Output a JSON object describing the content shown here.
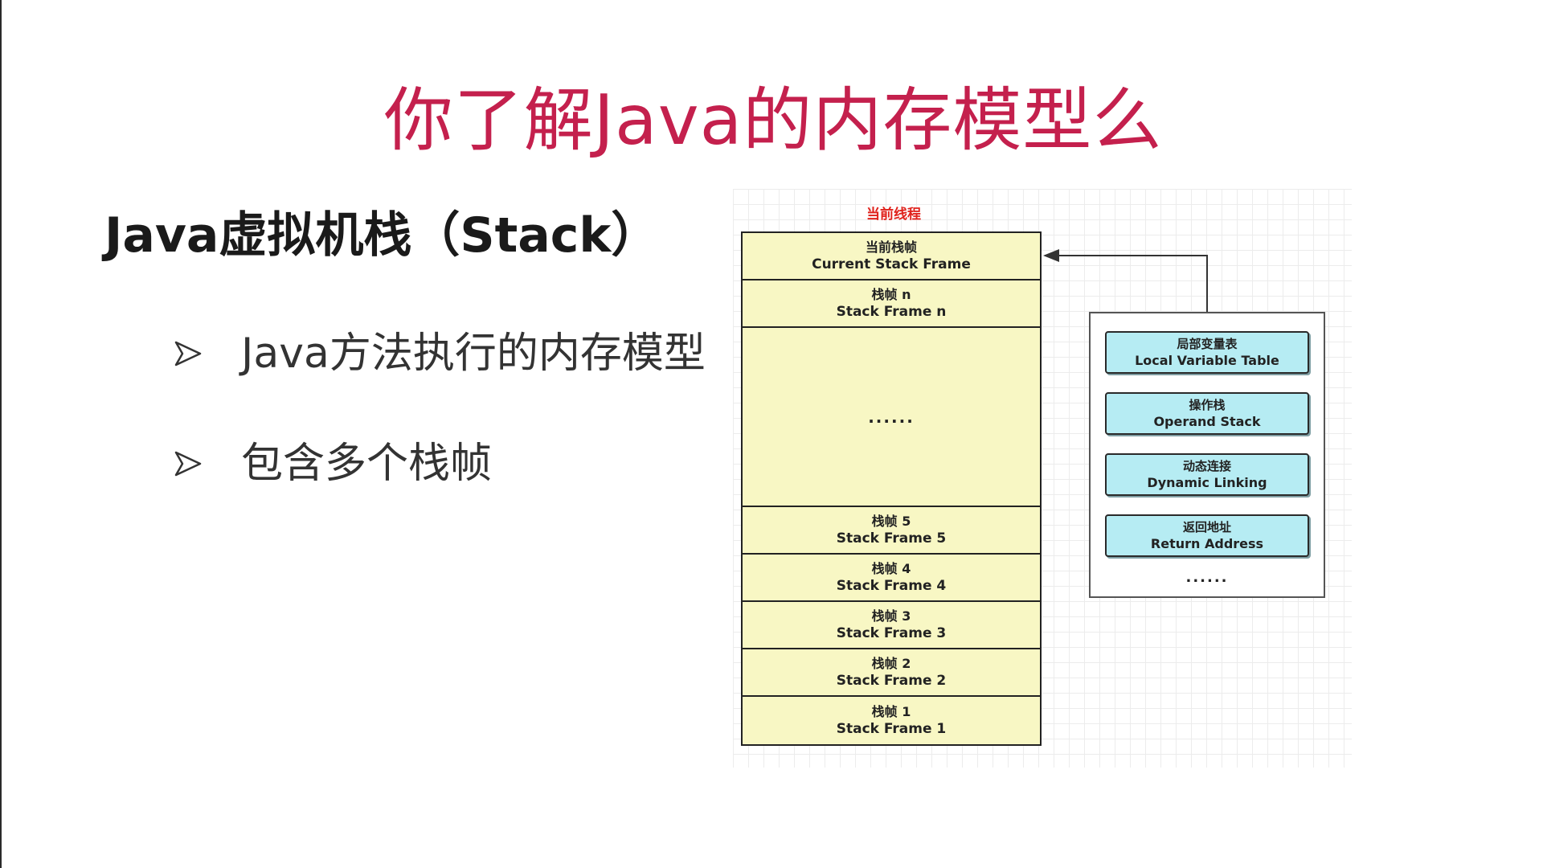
{
  "slide": {
    "title": "你了解Java的内存模型么",
    "heading": "Java虚拟机栈（Stack）",
    "bullets": [
      "Java方法执行的内存模型",
      "包含多个栈帧"
    ]
  },
  "diagram": {
    "thread_label": "当前线程",
    "stack_frames": [
      {
        "zh": "当前栈帧",
        "en": "Current Stack Frame"
      },
      {
        "zh": "栈帧 n",
        "en": "Stack Frame n"
      },
      {
        "ellipsis": "......"
      },
      {
        "zh": "栈帧 5",
        "en": "Stack Frame 5"
      },
      {
        "zh": "栈帧 4",
        "en": "Stack Frame 4"
      },
      {
        "zh": "栈帧 3",
        "en": "Stack Frame 3"
      },
      {
        "zh": "栈帧 2",
        "en": "Stack Frame 2"
      },
      {
        "zh": "栈帧 1",
        "en": "Stack Frame 1"
      }
    ],
    "frame_parts": [
      {
        "zh": "局部变量表",
        "en": "Local Variable Table"
      },
      {
        "zh": "操作栈",
        "en": "Operand Stack"
      },
      {
        "zh": "动态连接",
        "en": "Dynamic Linking"
      },
      {
        "zh": "返回地址",
        "en": "Return Address"
      }
    ],
    "frame_parts_more": "......"
  },
  "colors": {
    "title": "#c4204d",
    "thread_label": "#e0221c",
    "stack_frame_fill": "#f8f7c4",
    "frame_part_fill": "#b6ecf3"
  }
}
